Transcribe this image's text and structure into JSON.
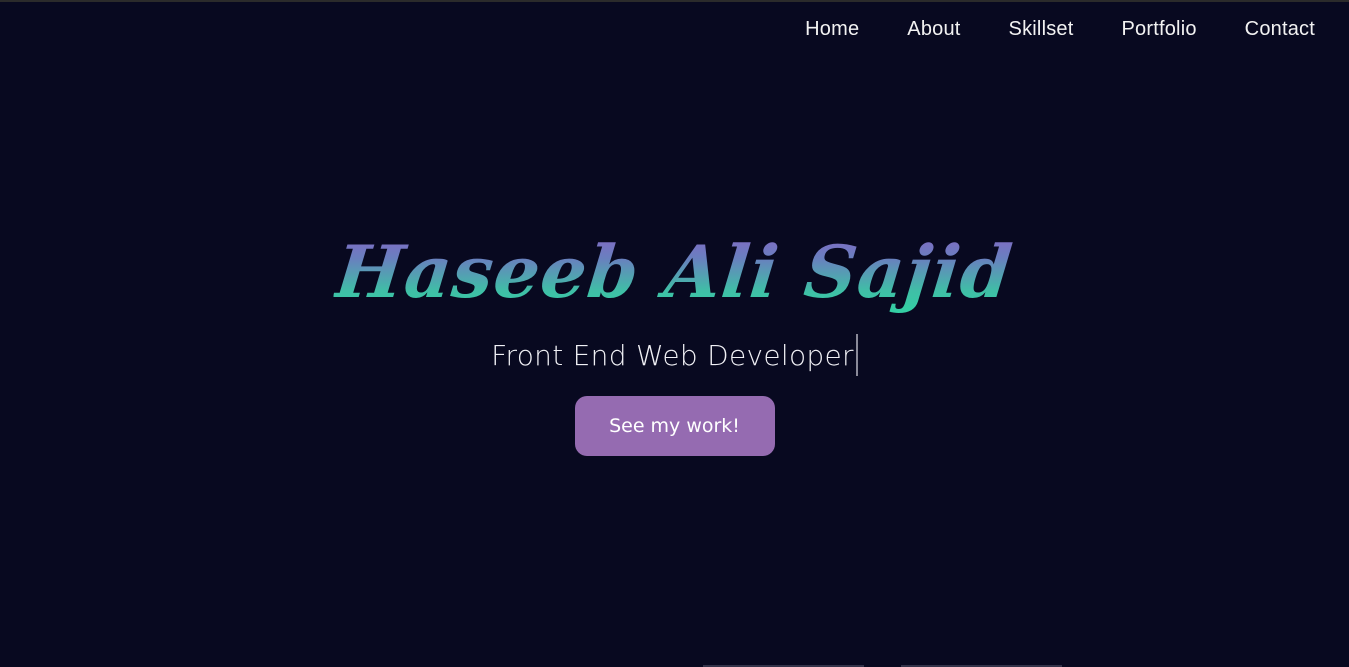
{
  "nav": {
    "items": [
      {
        "label": "Home"
      },
      {
        "label": "About"
      },
      {
        "label": "Skillset"
      },
      {
        "label": "Portfolio"
      },
      {
        "label": "Contact"
      }
    ]
  },
  "hero": {
    "name": "Haseeb Ali Sajid",
    "subtitle": "Front End Web Developer",
    "cta_label": "See my work!"
  },
  "colors": {
    "background": "#080920",
    "accent_button": "#956bb1",
    "name_gradient_top": "#8d5fc7",
    "name_gradient_bottom": "#2fd5a3"
  }
}
